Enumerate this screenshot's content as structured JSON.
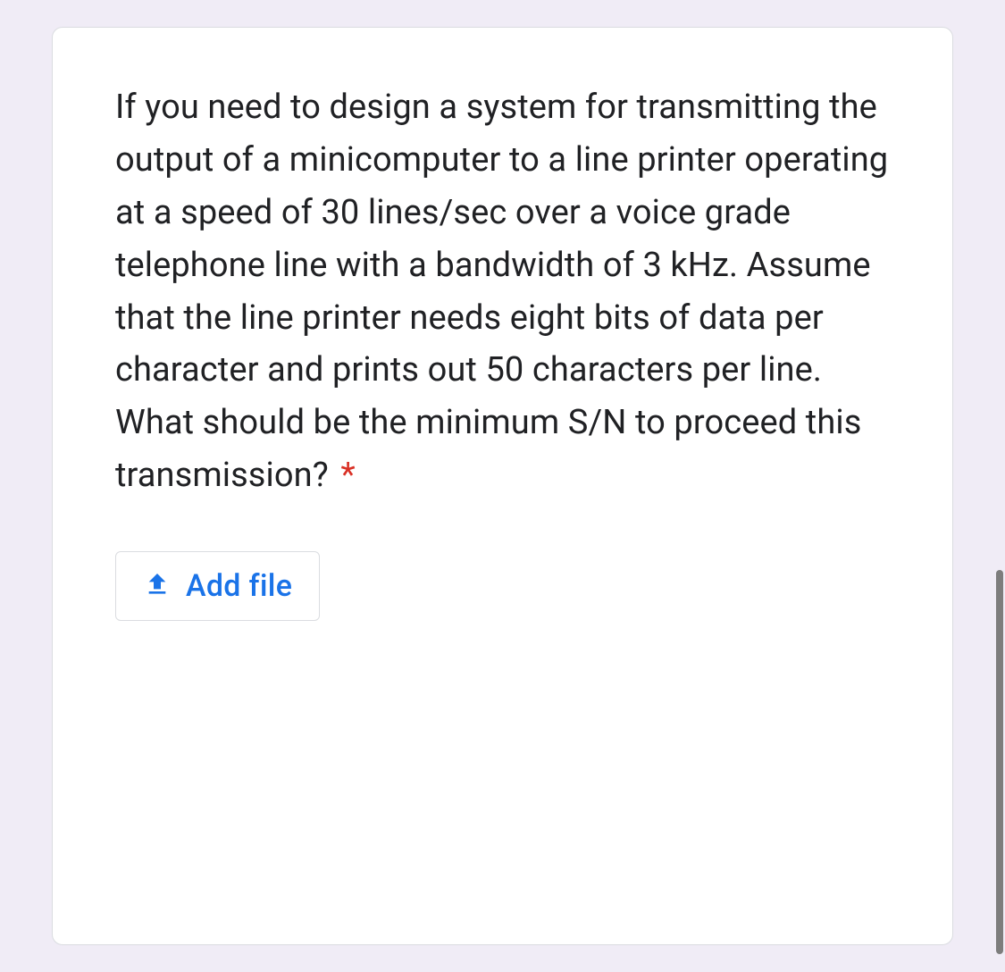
{
  "question": {
    "text": "If you need to design a system for transmitting the output of a minicomputer to a line printer operating at a speed of 30 lines/sec over a voice grade telephone line with a bandwidth of 3 kHz. Assume that the line printer needs eight bits of data per character and prints out 50 characters per line. What should be the minimum S/N to proceed this transmission?",
    "required_marker": "*"
  },
  "add_file": {
    "label": "Add file"
  }
}
